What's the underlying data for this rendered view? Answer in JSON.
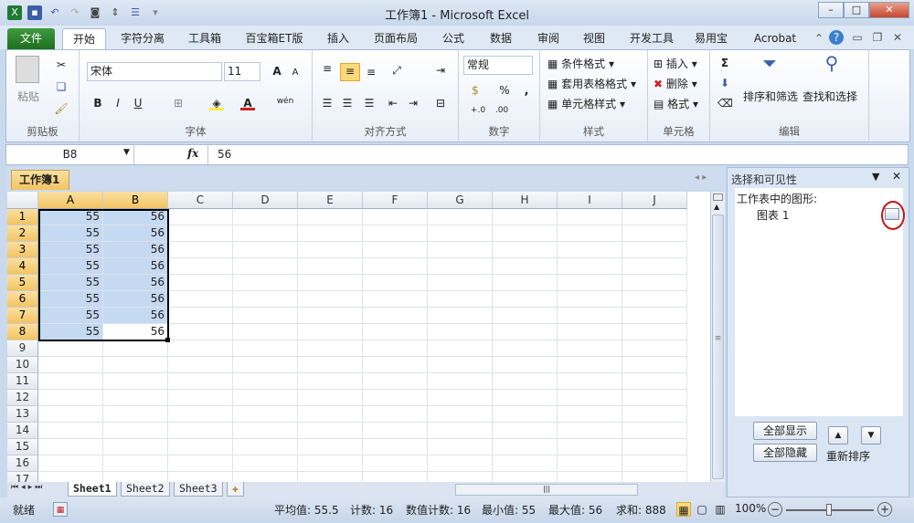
{
  "window": {
    "title": "工作簿1 - Microsoft Excel",
    "min": "–",
    "max": "□",
    "close": "✕"
  },
  "ribbon_tabs": [
    "文件",
    "开始",
    "字符分离",
    "工具箱",
    "百宝箱ET版",
    "插入",
    "页面布局",
    "公式",
    "数据",
    "审阅",
    "视图",
    "开发工具",
    "易用宝",
    "Acrobat"
  ],
  "ribbon": {
    "clipboard": {
      "label": "剪贴板",
      "paste": "粘贴"
    },
    "font": {
      "label": "字体",
      "name": "宋体",
      "size": "11",
      "bold": "B",
      "italic": "I",
      "underline": "U",
      "grow": "A",
      "shrink": "A",
      "phonetic": "wén"
    },
    "alignment": {
      "label": "对齐方式"
    },
    "number": {
      "label": "数字",
      "format": "常规",
      "percent": "%",
      "comma": ",",
      "inc": "+.0",
      "dec": ".00"
    },
    "styles": {
      "label": "样式",
      "conditional": "条件格式",
      "table": "套用表格格式",
      "cell": "单元格样式"
    },
    "cells": {
      "label": "单元格",
      "insert": "插入",
      "delete": "删除",
      "format": "格式"
    },
    "editing": {
      "label": "编辑",
      "sum": "Σ",
      "sort": "排序和筛选",
      "find": "查找和选择"
    }
  },
  "formula_bar": {
    "name_box": "B8",
    "fx": "fx",
    "value": "56"
  },
  "workbook_tab": "工作簿1",
  "columns": [
    "A",
    "B",
    "C",
    "D",
    "E",
    "F",
    "G",
    "H",
    "I",
    "J"
  ],
  "rows": [
    "1",
    "2",
    "3",
    "4",
    "5",
    "6",
    "7",
    "8",
    "9",
    "10",
    "11",
    "12",
    "13",
    "14",
    "15",
    "16",
    "17"
  ],
  "cells": [
    [
      "55",
      "56"
    ],
    [
      "55",
      "56"
    ],
    [
      "55",
      "56"
    ],
    [
      "55",
      "56"
    ],
    [
      "55",
      "56"
    ],
    [
      "55",
      "56"
    ],
    [
      "55",
      "56"
    ],
    [
      "55",
      "56"
    ]
  ],
  "sheets": [
    "Sheet1",
    "Sheet2",
    "Sheet3"
  ],
  "pane": {
    "title": "选择和可见性",
    "heading": "工作表中的图形:",
    "items": [
      "图表 1"
    ],
    "show_all": "全部显示",
    "hide_all": "全部隐藏",
    "reorder": "重新排序"
  },
  "status": {
    "ready": "就绪",
    "average": "平均值: 55.5",
    "count": "计数: 16",
    "numcount": "数值计数: 16",
    "min": "最小值: 55",
    "max": "最大值: 56",
    "sum": "求和: 888",
    "zoom": "100%"
  },
  "colors": {
    "accent": "#f3c462",
    "selection": "#c5d9f1",
    "file_tab": "#2a7d2a"
  }
}
